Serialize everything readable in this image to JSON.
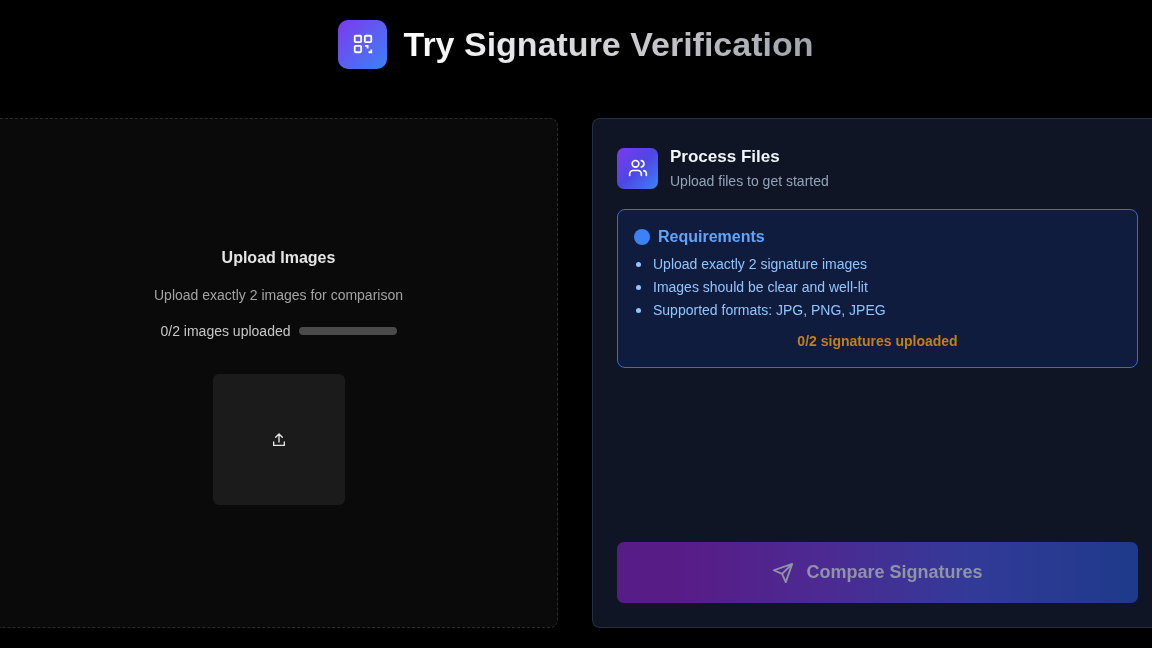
{
  "header": {
    "title": "Try Signature Verification"
  },
  "upload_panel": {
    "title": "Upload Images",
    "subtitle": "Upload exactly 2 images for comparison",
    "progress_label": "0/2 images uploaded",
    "level": 0
  },
  "process_panel": {
    "title": "Process Files",
    "subtitle": "Upload files to get started",
    "requirements": {
      "title": "Requirements",
      "items": [
        "Upload exactly 2 signature images",
        "Images should be clear and well-lit",
        "Supported formats: JPG, PNG, JPEG"
      ],
      "status": "0/2 signatures uploaded"
    },
    "button": {
      "label": "Compare Signatures",
      "disabled": true
    }
  }
}
